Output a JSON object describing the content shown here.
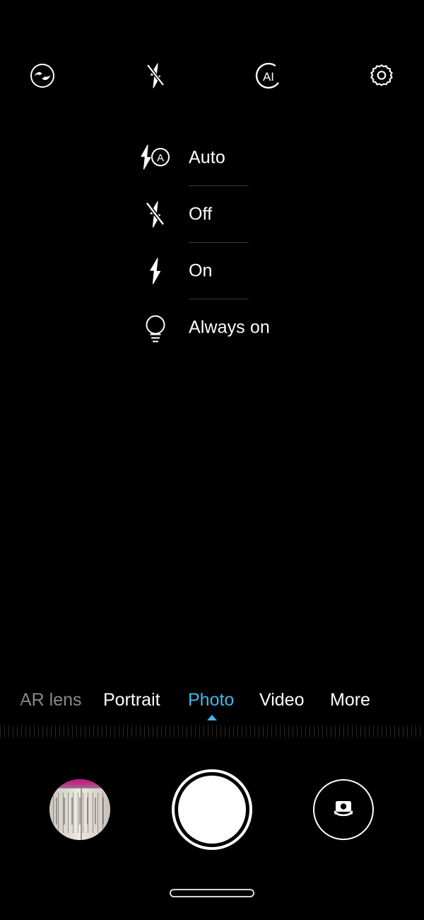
{
  "app": {
    "name": "Camera",
    "background_color": "#000000",
    "accent_color": "#3fb9ea"
  },
  "topbar": {
    "icons": [
      {
        "name": "moving-picture-icon",
        "label": "Moving picture",
        "state": "off"
      },
      {
        "name": "flash-off-icon",
        "label": "Flash",
        "state": "Off"
      },
      {
        "name": "ai-icon",
        "label": "AI",
        "state": "on"
      },
      {
        "name": "settings-gear-icon",
        "label": "Settings",
        "state": ""
      }
    ]
  },
  "flash_menu": {
    "open": true,
    "selected": "Off",
    "options": [
      {
        "label": "Auto",
        "icon": "flash-auto-icon"
      },
      {
        "label": "Off",
        "icon": "flash-off-icon"
      },
      {
        "label": "On",
        "icon": "flash-on-icon"
      },
      {
        "label": "Always on",
        "icon": "lightbulb-icon"
      }
    ]
  },
  "modes": {
    "selected": "Photo",
    "items": [
      {
        "label": "AR lens",
        "state": "dim"
      },
      {
        "label": "Portrait",
        "state": "normal"
      },
      {
        "label": "Photo",
        "state": "active"
      },
      {
        "label": "Video",
        "state": "normal"
      },
      {
        "label": "More",
        "state": "normal"
      }
    ]
  },
  "controls": {
    "gallery_thumbnail": {
      "name": "gallery-thumbnail",
      "alt": "Last photo: open book"
    },
    "shutter": {
      "name": "shutter-button",
      "label": "Shutter"
    },
    "switch_camera": {
      "name": "switch-camera-button",
      "label": "Switch camera"
    }
  },
  "navbar": {
    "home_indicator": "home-indicator"
  }
}
